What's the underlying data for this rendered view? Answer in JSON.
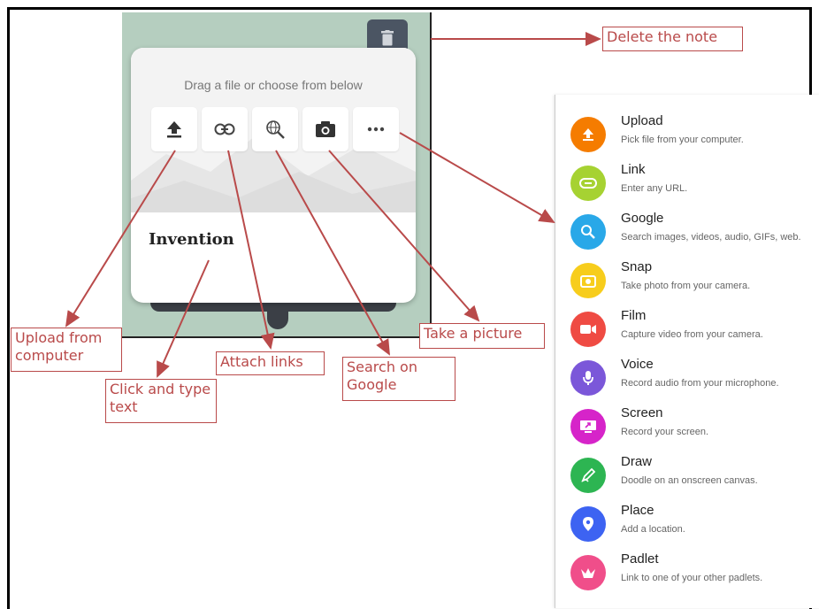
{
  "note": {
    "drag_hint": "Drag a file or choose from below",
    "title": "Invention",
    "attach_buttons": [
      {
        "icon": "upload-icon"
      },
      {
        "icon": "link-icon"
      },
      {
        "icon": "search-web-icon"
      },
      {
        "icon": "camera-icon"
      },
      {
        "icon": "more-icon"
      }
    ],
    "delete_icon": "trash-icon"
  },
  "callouts": {
    "delete": "Delete the note",
    "upload": "Upload from computer",
    "click_type": "Click and type  text",
    "attach_links": "Attach links",
    "search_google": "Search on Google",
    "take_picture": "Take a picture"
  },
  "menu": {
    "items": [
      {
        "title": "Upload",
        "desc": "Pick file from your computer.",
        "color": "#f57c00",
        "icon": "upload-icon"
      },
      {
        "title": "Link",
        "desc": "Enter any URL.",
        "color": "#a6d232",
        "icon": "link-icon"
      },
      {
        "title": "Google",
        "desc": "Search images, videos, audio, GIFs, web.",
        "color": "#29a8e8",
        "icon": "search-web-icon"
      },
      {
        "title": "Snap",
        "desc": "Take photo from your camera.",
        "color": "#f7cd1c",
        "icon": "camera-icon"
      },
      {
        "title": "Film",
        "desc": "Capture video from your camera.",
        "color": "#ef4b43",
        "icon": "video-icon"
      },
      {
        "title": "Voice",
        "desc": "Record audio from your microphone.",
        "color": "#7b57d9",
        "icon": "microphone-icon"
      },
      {
        "title": "Screen",
        "desc": "Record your screen.",
        "color": "#d624c9",
        "icon": "screen-record-icon"
      },
      {
        "title": "Draw",
        "desc": "Doodle on an onscreen canvas.",
        "color": "#2db552",
        "icon": "draw-icon"
      },
      {
        "title": "Place",
        "desc": "Add a location.",
        "color": "#3d63f2",
        "icon": "location-pin-icon"
      },
      {
        "title": "Padlet",
        "desc": "Link to one of your other padlets.",
        "color": "#f04e8a",
        "icon": "padlet-icon"
      }
    ]
  },
  "colors": {
    "annotation": "#b94a4a",
    "note_background": "#b5cebf",
    "dark_button": "#4b5563"
  }
}
